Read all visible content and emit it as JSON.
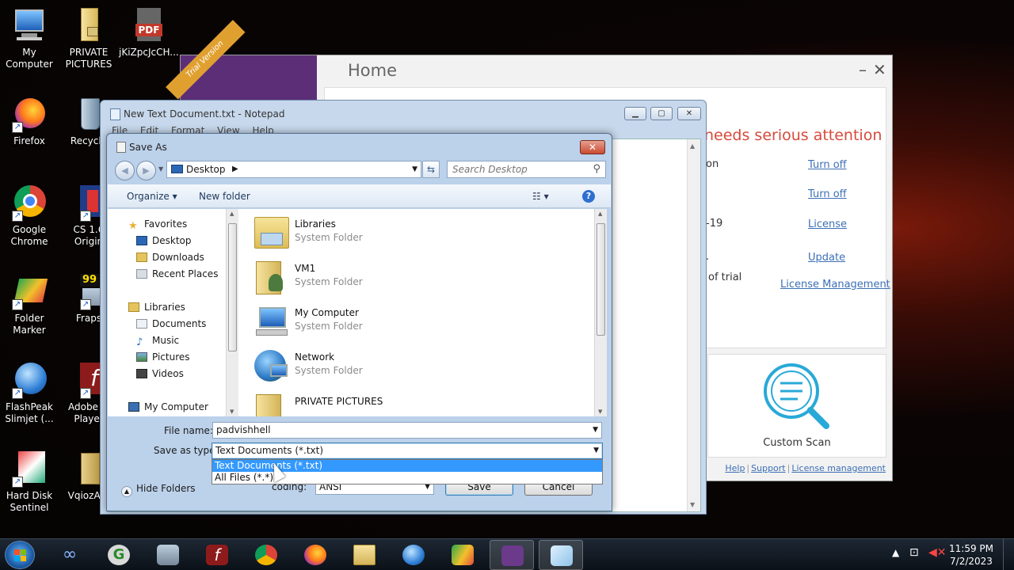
{
  "desktop": {
    "icons": [
      {
        "label": "My\nComputer",
        "icon": "computer-icon"
      },
      {
        "label": "PRIVATE\nPICTURES",
        "icon": "locked-folder-icon"
      },
      {
        "label": "jKiZpcJcCH...",
        "icon": "pdf-icon",
        "badge": "PDF"
      },
      {
        "label": "Firefox",
        "icon": "firefox-icon"
      },
      {
        "label": "Recycle",
        "icon": "recycle-bin-icon"
      },
      {
        "label": "Google\nChrome",
        "icon": "chrome-icon"
      },
      {
        "label": "CS 1.6\nOrigin",
        "icon": "cs-icon"
      },
      {
        "label": "Folder\nMarker",
        "icon": "folder-marker-icon"
      },
      {
        "label": "Fraps",
        "icon": "fraps-icon",
        "badge": "99"
      },
      {
        "label": "FlashPeak\nSlimjet (...",
        "icon": "slimjet-icon"
      },
      {
        "label": "Adobe Fl\nPlayer",
        "icon": "flash-icon"
      },
      {
        "label": "Hard Disk\nSentinel",
        "icon": "hdsentinel-icon"
      },
      {
        "label": "VqiozAm",
        "icon": "folder-icon"
      }
    ]
  },
  "antivirus": {
    "ribbon": "Trial Version",
    "title": "Home",
    "alert": "needs serious attention",
    "rows": [
      {
        "text": "on",
        "link": "Turn off"
      },
      {
        "text": "",
        "link": "Turn off"
      },
      {
        "text": "-19",
        "link": "License"
      },
      {
        "text": ".",
        "link": "Update"
      },
      {
        "text": "of trial",
        "link": "License Management"
      }
    ],
    "scan_label": "Custom Scan",
    "footer": {
      "help": "Help",
      "support": "Support",
      "license": "License management"
    }
  },
  "notepad": {
    "title": "New Text Document.txt - Notepad",
    "menu": [
      "File",
      "Edit",
      "Format",
      "View",
      "Help"
    ]
  },
  "save_dialog": {
    "title": "Save As",
    "address": "Desktop",
    "search_placeholder": "Search Desktop",
    "organize": "Organize",
    "new_folder": "New folder",
    "nav": {
      "favorites": "Favorites",
      "desktop": "Desktop",
      "downloads": "Downloads",
      "recent": "Recent Places",
      "libraries": "Libraries",
      "documents": "Documents",
      "music": "Music",
      "pictures": "Pictures",
      "videos": "Videos",
      "computer": "My Computer"
    },
    "files": [
      {
        "name": "Libraries",
        "type": "System Folder"
      },
      {
        "name": "VM1",
        "type": "System Folder"
      },
      {
        "name": "My Computer",
        "type": "System Folder"
      },
      {
        "name": "Network",
        "type": "System Folder"
      },
      {
        "name": "PRIVATE PICTURES",
        "type": ""
      }
    ],
    "file_name_label": "File name:",
    "file_name_value": "padvishhell",
    "save_type_label": "Save as type:",
    "save_type_value": "Text Documents (*.txt)",
    "type_options": [
      "Text Documents (*.txt)",
      "All Files  (*.*)"
    ],
    "hide_folders": "Hide Folders",
    "encoding_label": "Encoding:",
    "encoding_visible_label": "coding:",
    "encoding_value": "ANSI",
    "save": "Save",
    "cancel": "Cancel"
  },
  "taskbar": {
    "time": "11:59 PM",
    "date": "7/2/2023"
  }
}
